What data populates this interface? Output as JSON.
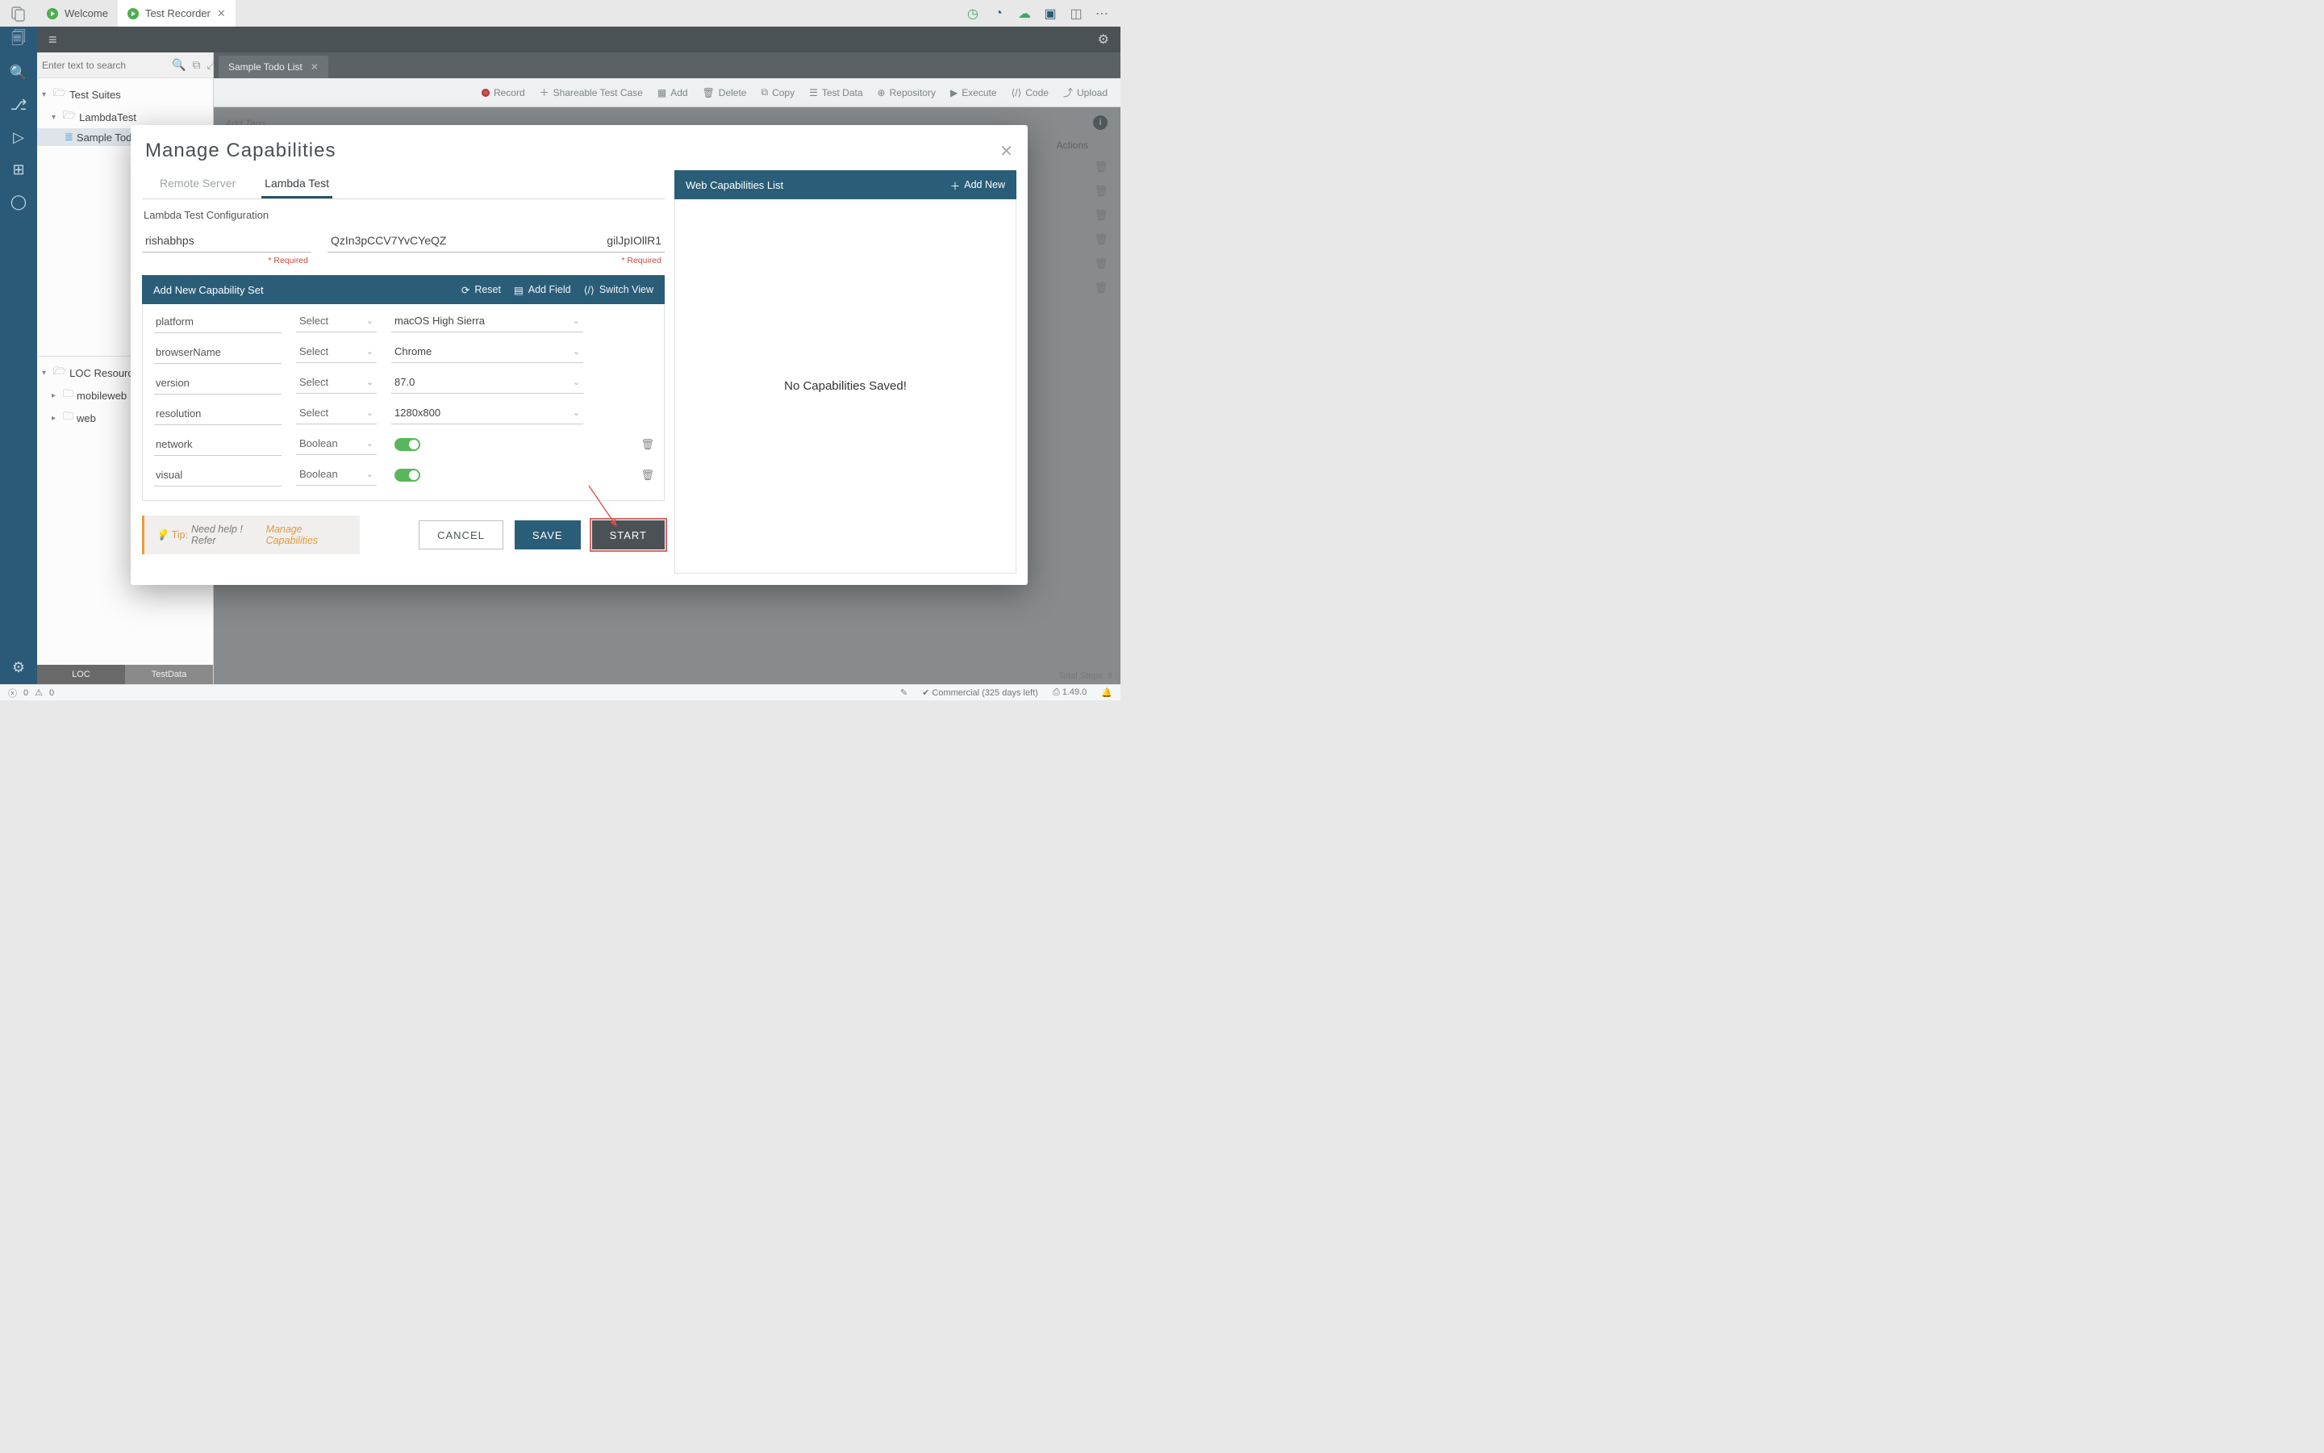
{
  "tabs": {
    "welcome": "Welcome",
    "recorder": "Test Recorder"
  },
  "sidebar": {
    "search_placeholder": "Enter text to search",
    "test_suites": "Test Suites",
    "lambda": "LambdaTest",
    "sample": "Sample Todo List",
    "loc": "LOC Resources",
    "mobileweb": "mobileweb",
    "web": "web",
    "tab_loc": "LOC",
    "tab_testdata": "TestData"
  },
  "doc": {
    "tab": "Sample Todo List",
    "toolbar": {
      "record": "Record",
      "shareable": "Shareable Test Case",
      "add": "Add",
      "delete": "Delete",
      "copy": "Copy",
      "testdata": "Test Data",
      "repository": "Repository",
      "execute": "Execute",
      "code": "Code",
      "upload": "Upload"
    },
    "add_tags": "Add Tags",
    "actions": "Actions",
    "total_steps_lbl": "Total Steps:",
    "total_steps_val": "6"
  },
  "modal": {
    "title": "Manage Capabilities",
    "subtabs": {
      "remote": "Remote Server",
      "lambda": "Lambda Test"
    },
    "config_label": "Lambda Test Configuration",
    "username": "rishabhps",
    "token": "QzIn3pCCV7YvCYeQZgilJpIOllR1",
    "token_display_left": "QzIn3pCCV7YvCYeQZ",
    "token_display_right": "gilJpIOllR1",
    "required": "* Required",
    "capset": {
      "title": "Add New Capability Set",
      "reset": "Reset",
      "add_field": "Add Field",
      "switch_view": "Switch View",
      "rows": [
        {
          "name": "platform",
          "type": "Select",
          "value": "macOS High Sierra"
        },
        {
          "name": "browserName",
          "type": "Select",
          "value": "Chrome"
        },
        {
          "name": "version",
          "type": "Select",
          "value": "87.0"
        },
        {
          "name": "resolution",
          "type": "Select",
          "value": "1280x800"
        },
        {
          "name": "network",
          "type": "Boolean",
          "value": true
        },
        {
          "name": "visual",
          "type": "Boolean",
          "value": true
        }
      ]
    },
    "tip_label": "Tip:",
    "tip_text": "Need help ! Refer",
    "tip_link": "Manage Capabilities",
    "btn_cancel": "CANCEL",
    "btn_save": "SAVE",
    "btn_start": "START",
    "weblist_title": "Web Capabilities List",
    "weblist_add": "Add New",
    "weblist_empty": "No Capabilities Saved!"
  },
  "status": {
    "err": "0",
    "warn": "0",
    "license": "Commercial (325 days left)",
    "version": "1.49.0"
  }
}
